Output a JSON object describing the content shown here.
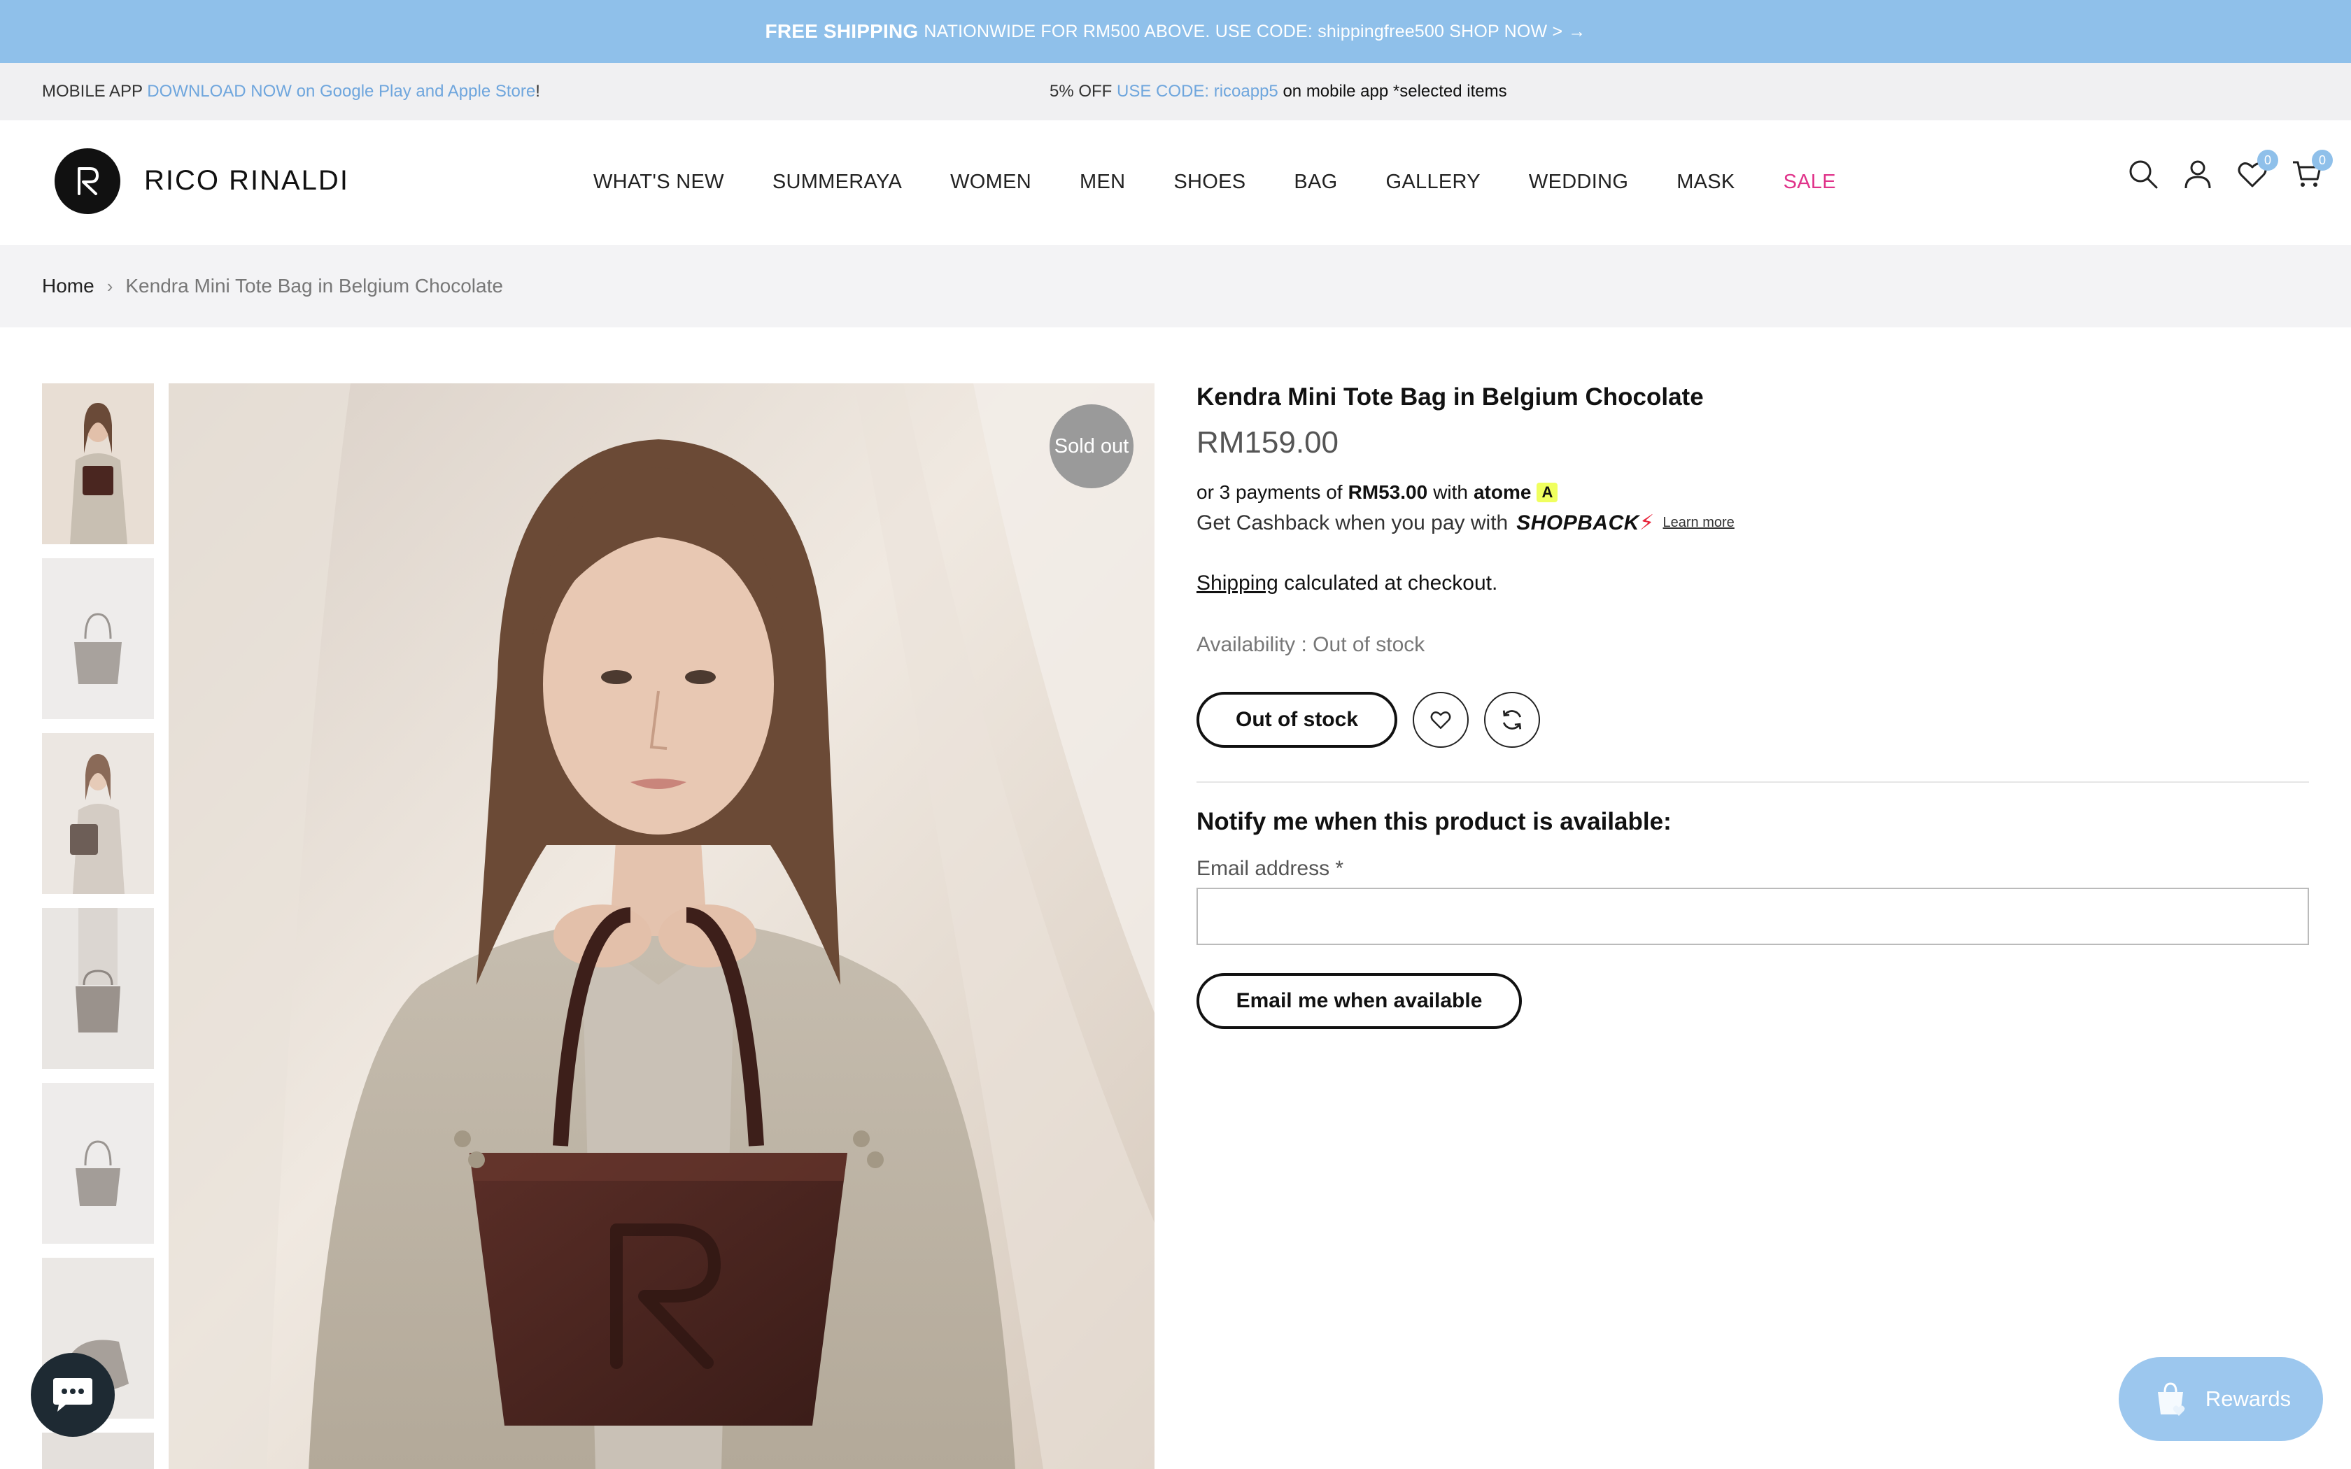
{
  "announcement": {
    "bold": "FREE SHIPPING",
    "text": "NATIONWIDE FOR RM500 ABOVE. USE CODE: shippingfree500 SHOP NOW >",
    "arrow": "→"
  },
  "promo": {
    "left_prefix": "MOBILE APP",
    "left_link": "DOWNLOAD NOW on Google Play and Apple Store",
    "left_suffix": "!",
    "center_prefix": "5% OFF",
    "center_code": "USE CODE: ricoapp5",
    "center_suffix": "on mobile app *selected items"
  },
  "header": {
    "brand": "RICO RINALDI",
    "nav": [
      "WHAT'S NEW",
      "SUMMERAYA",
      "WOMEN",
      "MEN",
      "SHOES",
      "BAG",
      "GALLERY",
      "WEDDING",
      "MASK",
      "SALE"
    ],
    "wishlist_count": "0",
    "cart_count": "0",
    "icons": [
      "search-icon",
      "account-icon",
      "heart-icon",
      "cart-icon"
    ]
  },
  "breadcrumb": {
    "home": "Home",
    "separator": "›",
    "current": "Kendra Mini Tote Bag in Belgium Chocolate"
  },
  "gallery": {
    "badge": "Sold out"
  },
  "product": {
    "title": "Kendra Mini Tote Bag in Belgium Chocolate",
    "price": "RM159.00",
    "atome_prefix": "or 3 payments of",
    "atome_amount": "RM53.00",
    "atome_with": "with",
    "atome_brand": "atome",
    "shopback_text": "Get Cashback when you pay with",
    "shopback_brand": "SHOPBACK",
    "learn_more": "Learn more",
    "shipping_link": "Shipping",
    "shipping_rest": "calculated at checkout.",
    "availability": "Availability : Out of stock",
    "oos_button": "Out of stock",
    "notify_title": "Notify me when this product is available:",
    "email_label": "Email address *",
    "email_value": "",
    "email_button": "Email me when available"
  },
  "widgets": {
    "rewards": "Rewards"
  },
  "colors": {
    "announce_bg": "#8fc0ea",
    "accent_blue": "#6fa6dd",
    "sale_pink": "#e0338a",
    "bag_brown": "#4a2620"
  }
}
